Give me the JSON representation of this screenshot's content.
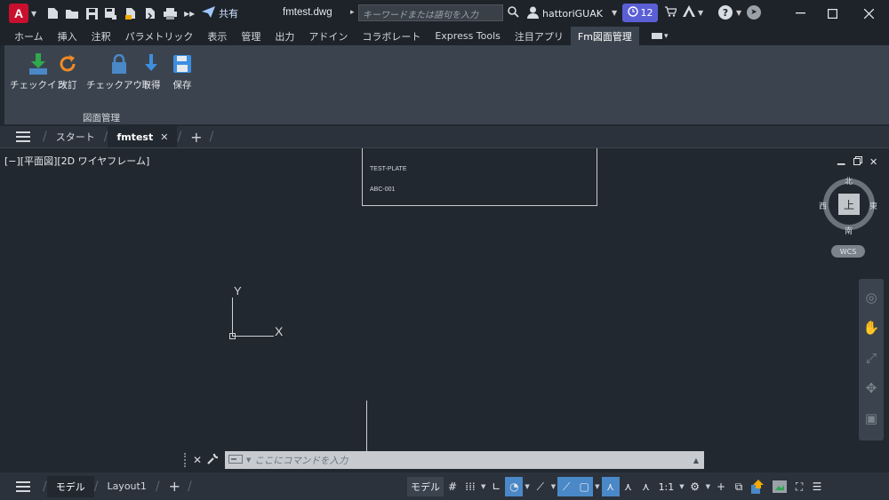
{
  "titlebar": {
    "app_letter": "A",
    "share_label": "共有",
    "file_title": "fmtest.dwg",
    "search_placeholder": "キーワードまたは語句を入力",
    "user_name": "hattoriGUAK",
    "notification_count": "12"
  },
  "ribbon_tabs": [
    {
      "label": "ホーム"
    },
    {
      "label": "挿入"
    },
    {
      "label": "注釈"
    },
    {
      "label": "パラメトリック"
    },
    {
      "label": "表示"
    },
    {
      "label": "管理"
    },
    {
      "label": "出力"
    },
    {
      "label": "アドイン"
    },
    {
      "label": "コラボレート"
    },
    {
      "label": "Express Tools"
    },
    {
      "label": "注目アプリ"
    },
    {
      "label": "Fm図面管理"
    }
  ],
  "ribbon_panel": {
    "buttons": [
      {
        "label": "チェックイン"
      },
      {
        "label": "改訂"
      },
      {
        "label": "チェックアウト"
      },
      {
        "label": "取得"
      },
      {
        "label": "保存"
      }
    ],
    "panel_label": "図面管理"
  },
  "file_tabs": {
    "start": "スタート",
    "current": "fmtest"
  },
  "viewport": {
    "label": "[−][平面図][2D ワイヤフレーム]",
    "title_block_line1": "TEST-PLATE",
    "title_block_line2": "ABC-001",
    "ucs_x": "X",
    "ucs_y": "Y"
  },
  "viewcube": {
    "top": "上",
    "north": "北",
    "south": "南",
    "east": "東",
    "west": "西",
    "wcs": "WCS"
  },
  "command_line": {
    "placeholder": "ここにコマンドを入力"
  },
  "status_bar": {
    "layout_tabs": [
      {
        "label": "モデル"
      },
      {
        "label": "Layout1"
      }
    ],
    "model_label": "モデル",
    "scale_label": "1:1"
  },
  "colors": {
    "accent": "#4a88c7",
    "app_red": "#c8102e",
    "badge_purple": "#5b5fd6"
  }
}
